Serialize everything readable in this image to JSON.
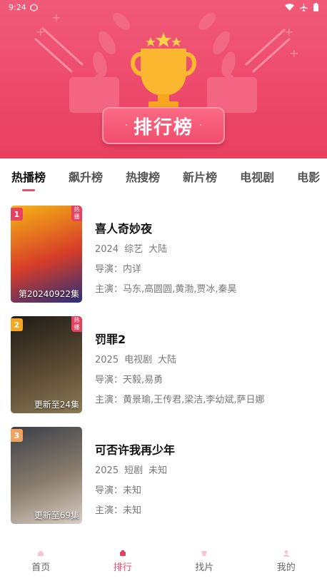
{
  "status_bar": {
    "time": "9:24"
  },
  "hero": {
    "title": "排行榜",
    "dot_left": "·",
    "dot_right": "·"
  },
  "tabs": [
    {
      "label": "热播榜",
      "active": true
    },
    {
      "label": "飙升榜",
      "active": false
    },
    {
      "label": "热搜榜",
      "active": false
    },
    {
      "label": "新片榜",
      "active": false
    },
    {
      "label": "电视剧",
      "active": false
    },
    {
      "label": "电影",
      "active": false
    }
  ],
  "items": [
    {
      "rank": "1",
      "rank_color": "#e8405f",
      "badge": "热播",
      "episode_text": "第20240922集",
      "title": "喜人奇妙夜",
      "year": "2024",
      "genre": "综艺",
      "region": "大陆",
      "director": "导演：内详",
      "cast": "主演：马东,高圆圆,黄渤,贾冰,秦昊",
      "poster_colors": [
        "#f7b514",
        "#d63d28",
        "#2a2f7a"
      ]
    },
    {
      "rank": "2",
      "rank_color": "#f5a623",
      "badge": "热播",
      "episode_text": "更新至24集",
      "title": "罚罪2",
      "year": "2025",
      "genre": "电视剧",
      "region": "大陆",
      "director": "导演：天毅,易勇",
      "cast": "主演：黄景瑜,王传君,梁洁,李幼斌,萨日娜",
      "poster_colors": [
        "#1e1b16",
        "#5a4a33",
        "#8b7a55"
      ]
    },
    {
      "rank": "3",
      "rank_color": "#f0a35e",
      "badge": "",
      "episode_text": "更新至69集",
      "title": "可否许我再少年",
      "year": "2025",
      "genre": "短剧",
      "region": "未知",
      "director": "导演：未知",
      "cast": "主演：未知",
      "poster_colors": [
        "#3b3f48",
        "#8a7d6e",
        "#d9cfc4"
      ]
    }
  ],
  "bottom_nav": [
    {
      "label": "首页",
      "icon": "home-icon",
      "active": false
    },
    {
      "label": "排行",
      "icon": "ranking-icon",
      "active": true
    },
    {
      "label": "找片",
      "icon": "search-film-icon",
      "active": false
    },
    {
      "label": "我的",
      "icon": "profile-icon",
      "active": false
    }
  ],
  "colors": {
    "accent": "#ee4a6c",
    "hero_bg": "#ef4f70",
    "trophy": "#fbb72f"
  }
}
